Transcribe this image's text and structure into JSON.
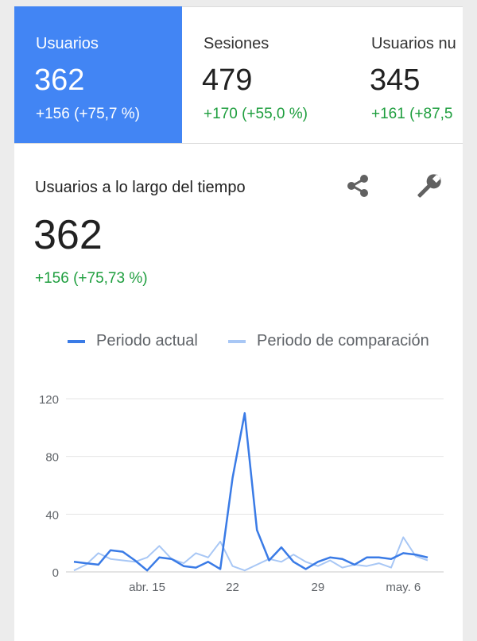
{
  "tabs": [
    {
      "label": "Usuarios",
      "value": "362",
      "delta": "+156 (+75,7 %)",
      "active": true
    },
    {
      "label": "Sesiones",
      "value": "479",
      "delta": "+170 (+55,0 %)",
      "active": false
    },
    {
      "label": "Usuarios nu",
      "value": "345",
      "delta": "+161 (+87,5",
      "active": false
    }
  ],
  "card": {
    "title": "Usuarios a lo largo del tiempo",
    "value": "362",
    "delta": "+156 (+75,73 %)",
    "share_icon": "share-icon",
    "tools_icon": "wrench-icon"
  },
  "colors": {
    "accent": "#4285f4",
    "current": "#3a7be6",
    "comparison": "#a8c7f5",
    "positive": "#1e9e3e"
  },
  "chart_data": {
    "type": "line",
    "title": "",
    "legend": [
      "Periodo actual",
      "Periodo de comparación"
    ],
    "legend_position": "top",
    "x_labels": [
      "abr. 15",
      "22",
      "29",
      "may. 6"
    ],
    "x_label_index": [
      6,
      13,
      20,
      27
    ],
    "ylim": [
      0,
      120
    ],
    "yticks": [
      "0",
      "40",
      "80",
      "120"
    ],
    "grid": true,
    "series": [
      {
        "name": "Periodo actual",
        "values": [
          7,
          6,
          5,
          15,
          14,
          8,
          1,
          10,
          9,
          4,
          3,
          7,
          2,
          65,
          110,
          29,
          8,
          17,
          7,
          2,
          7,
          10,
          9,
          5,
          10,
          10,
          9,
          13,
          12,
          10
        ]
      },
      {
        "name": "Periodo de comparación",
        "values": [
          1,
          5,
          13,
          9,
          8,
          7,
          10,
          18,
          9,
          6,
          13,
          10,
          21,
          4,
          1,
          5,
          9,
          7,
          12,
          7,
          4,
          8,
          3,
          5,
          4,
          6,
          3,
          24,
          11,
          8
        ]
      }
    ]
  }
}
